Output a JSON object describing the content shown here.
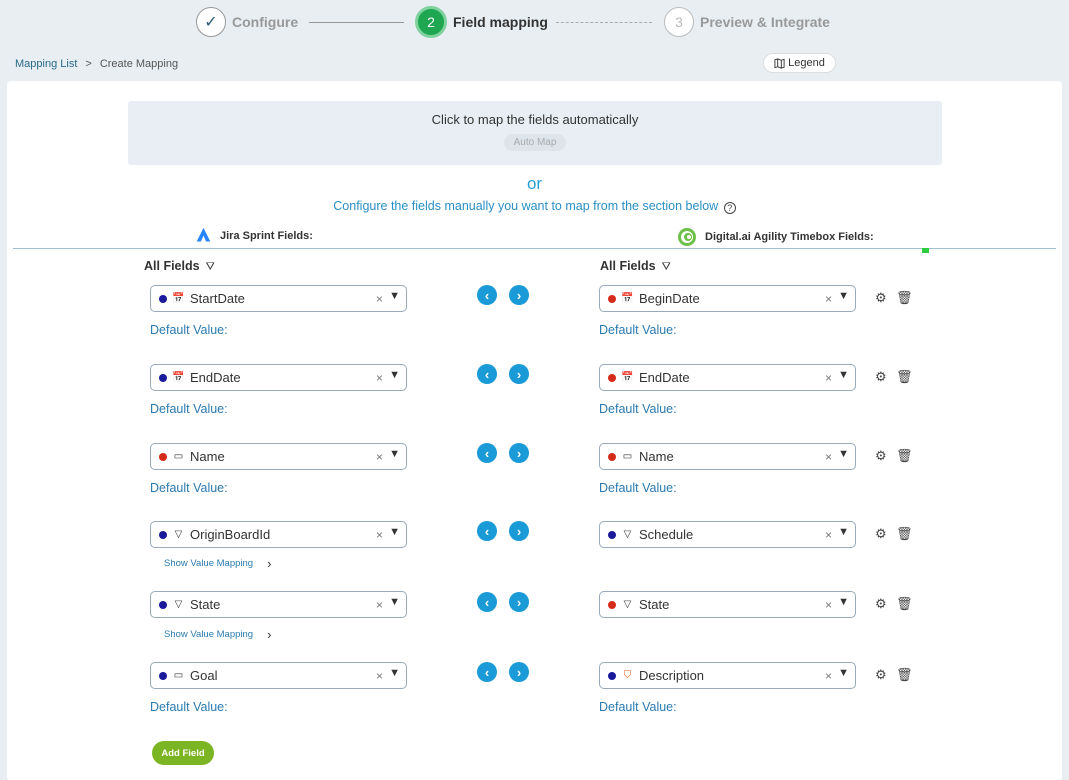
{
  "stepper": {
    "steps": [
      {
        "label": "Configure",
        "number": "✓",
        "state": "done"
      },
      {
        "label": "Field mapping",
        "number": "2",
        "state": "active"
      },
      {
        "label": "Preview & Integrate",
        "number": "3",
        "state": "pending"
      }
    ]
  },
  "breadcrumb": {
    "link": "Mapping List",
    "separator": ">",
    "current": "Create Mapping"
  },
  "legend": {
    "label": "Legend"
  },
  "auto_map": {
    "prompt": "Click to map the fields automatically",
    "button": "Auto Map"
  },
  "or_text": "or",
  "manual_text": "Configure the fields manually you want to map from the section below",
  "help_glyph": "?",
  "source": {
    "header": "Jira Sprint Fields:",
    "filter_label": "All Fields"
  },
  "target": {
    "header": "Digital.ai Agility Timebox Fields:",
    "filter_label": "All Fields"
  },
  "default_value_label": "Default Value:",
  "show_value_mapping_label": "Show Value Mapping",
  "rows": [
    {
      "left": "StartDate",
      "right": "BeginDate"
    },
    {
      "left": "EndDate",
      "right": "EndDate"
    },
    {
      "left": "Name",
      "right": "Name"
    },
    {
      "left": "OriginBoardId",
      "right": "Schedule"
    },
    {
      "left": "State",
      "right": "State"
    },
    {
      "left": "Goal",
      "right": "Description"
    }
  ],
  "add_field": "Add Field",
  "colors": {
    "accent": "#1a9ad6",
    "active_step": "#1ea650",
    "add_button": "#7cb524",
    "required_dot": "#d42b1a",
    "optional_dot": "#1a1a9a"
  }
}
